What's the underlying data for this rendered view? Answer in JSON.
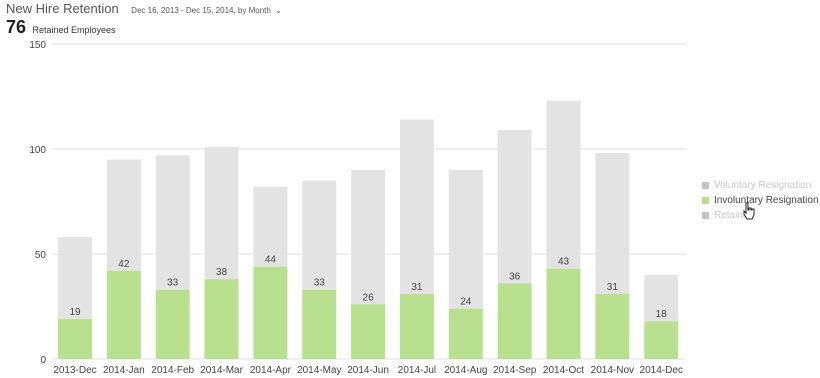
{
  "header": {
    "title": "New Hire Retention",
    "date_range": "Dec 16, 2013 - Dec 15, 2014, by Month"
  },
  "kpi": {
    "value": "76",
    "label": "Retained Employees"
  },
  "colors": {
    "voluntary": "#e3e3e3",
    "involuntary": "#b8e08f",
    "retained": "#cfcfcf",
    "grid": "#e0e0e0",
    "axis_text": "#444444"
  },
  "chart_data": {
    "type": "bar",
    "stacked": true,
    "categories": [
      "2013-Dec",
      "2014-Jan",
      "2014-Feb",
      "2014-Mar",
      "2014-Apr",
      "2014-May",
      "2014-Jun",
      "2014-Jul",
      "2014-Aug",
      "2014-Sep",
      "2014-Oct",
      "2014-Nov",
      "2014-Dec"
    ],
    "series": [
      {
        "name": "Involuntary Resignation",
        "values": [
          19,
          42,
          33,
          38,
          44,
          33,
          26,
          31,
          24,
          36,
          43,
          31,
          18
        ]
      },
      {
        "name": "Voluntary Resignation",
        "values": [
          39,
          53,
          64,
          63,
          38,
          52,
          64,
          83,
          66,
          73,
          80,
          67,
          22
        ]
      }
    ],
    "data_labels": [
      "19",
      "42",
      "33",
      "38",
      "44",
      "33",
      "26",
      "31",
      "24",
      "36",
      "43",
      "31",
      "18"
    ],
    "yticks": [
      "150",
      "100",
      "50",
      "0"
    ],
    "ylim": [
      0,
      150
    ],
    "grid": true,
    "legend_position": "right"
  },
  "legend": [
    {
      "label": "Voluntary Resignation",
      "state": "dim",
      "color_key": "voluntary"
    },
    {
      "label": "Involuntary Resignation",
      "state": "active",
      "color_key": "involuntary"
    },
    {
      "label": "Retained",
      "state": "dim",
      "color_key": "retained"
    }
  ]
}
